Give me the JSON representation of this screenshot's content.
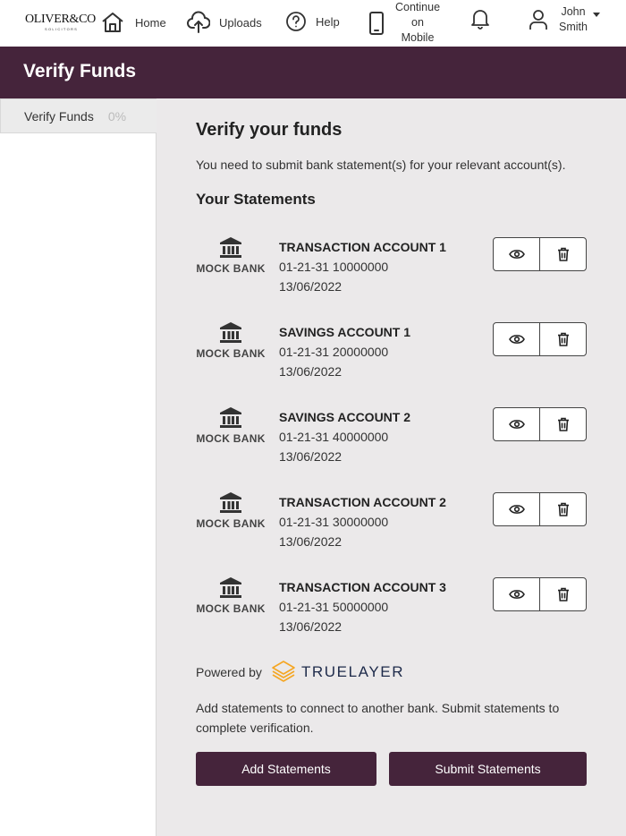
{
  "logo": {
    "name": "OLIVER&CO",
    "sub": "SOLICITORS"
  },
  "nav": {
    "home": "Home",
    "uploads": "Uploads",
    "help": "Help",
    "mobile_line1": "Continue",
    "mobile_line2": "on",
    "mobile_line3": "Mobile",
    "user_first": "John",
    "user_last": "Smith"
  },
  "header": {
    "title": "Verify Funds"
  },
  "sidebar": {
    "item_label": "Verify Funds",
    "item_progress": "0%"
  },
  "main": {
    "heading": "Verify your funds",
    "intro": "You need to submit bank statement(s) for your relevant account(s).",
    "statements_heading": "Your Statements"
  },
  "statements": [
    {
      "bank": "MOCK BANK",
      "account": "TRANSACTION ACCOUNT 1",
      "number": "01-21-31 10000000",
      "date": "13/06/2022"
    },
    {
      "bank": "MOCK BANK",
      "account": "SAVINGS ACCOUNT 1",
      "number": "01-21-31 20000000",
      "date": "13/06/2022"
    },
    {
      "bank": "MOCK BANK",
      "account": "SAVINGS ACCOUNT 2",
      "number": "01-21-31 40000000",
      "date": "13/06/2022"
    },
    {
      "bank": "MOCK BANK",
      "account": "TRANSACTION ACCOUNT 2",
      "number": "01-21-31 30000000",
      "date": "13/06/2022"
    },
    {
      "bank": "MOCK BANK",
      "account": "TRANSACTION ACCOUNT 3",
      "number": "01-21-31 50000000",
      "date": "13/06/2022"
    }
  ],
  "powered": {
    "label": "Powered by",
    "brand": "TRUELAYER"
  },
  "note": "Add statements to connect to another bank. Submit statements to complete verification.",
  "buttons": {
    "add": "Add Statements",
    "submit": "Submit Statements"
  },
  "colors": {
    "brand": "#45243b",
    "background": "#ebe9ea",
    "truelayer_orange": "#f5a623"
  },
  "icons": [
    "home-icon",
    "upload-icon",
    "help-icon",
    "mobile-icon",
    "bell-icon",
    "user-icon",
    "bank-icon",
    "eye-icon",
    "trash-icon"
  ]
}
